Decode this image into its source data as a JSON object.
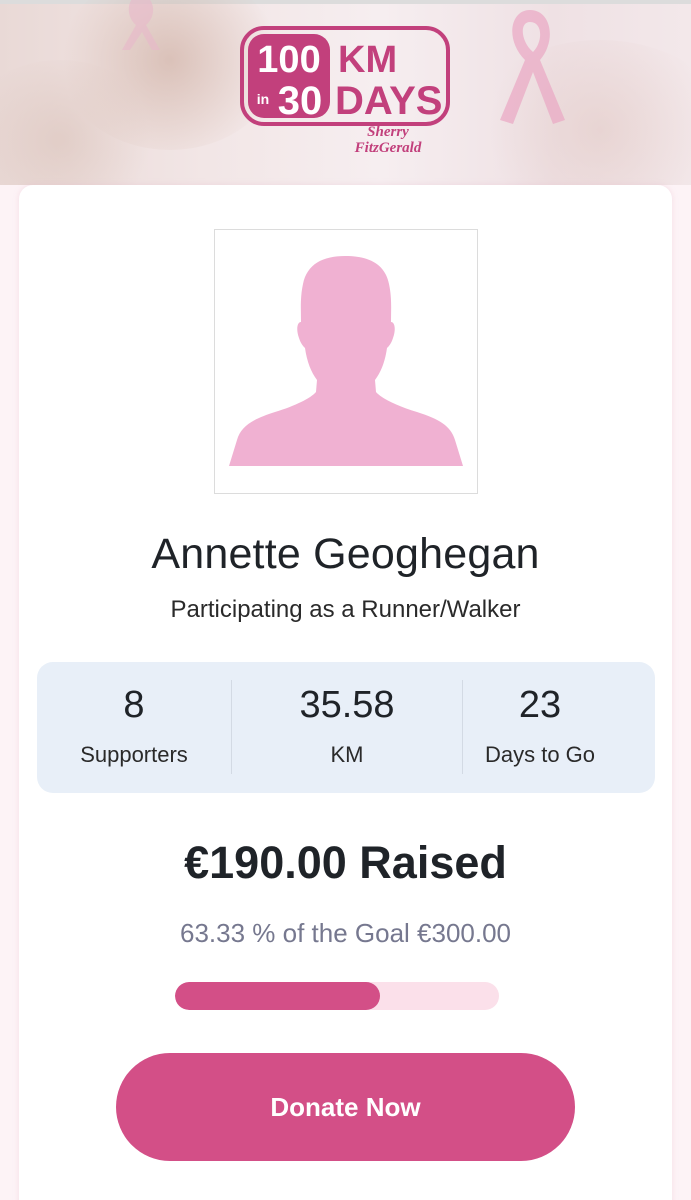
{
  "banner": {
    "logo": {
      "line1_number": "100",
      "line1_unit": "KM",
      "small_word": "in",
      "line2_number": "30",
      "line2_unit": "DAYS",
      "brand_line1": "Sherry",
      "brand_line2": "FitzGerald"
    }
  },
  "participant": {
    "name": "Annette Geoghegan",
    "role": "Participating as a Runner/Walker",
    "avatar_icon": "person-silhouette-icon"
  },
  "stats": [
    {
      "value": "8",
      "label": "Supporters"
    },
    {
      "value": "35.58",
      "label": "KM"
    },
    {
      "value": "23",
      "label": "Days to Go"
    }
  ],
  "fundraising": {
    "raised_text": "€190.00 Raised",
    "goal_text": "63.33 % of the Goal €300.00",
    "progress_fraction": 0.6333
  },
  "donate_button": {
    "label": "Donate Now"
  },
  "colors": {
    "accent": "#d34f87",
    "accent_light": "#fbe0ea",
    "stats_bg": "#e8eff8",
    "silhouette": "#f0b1d2"
  }
}
